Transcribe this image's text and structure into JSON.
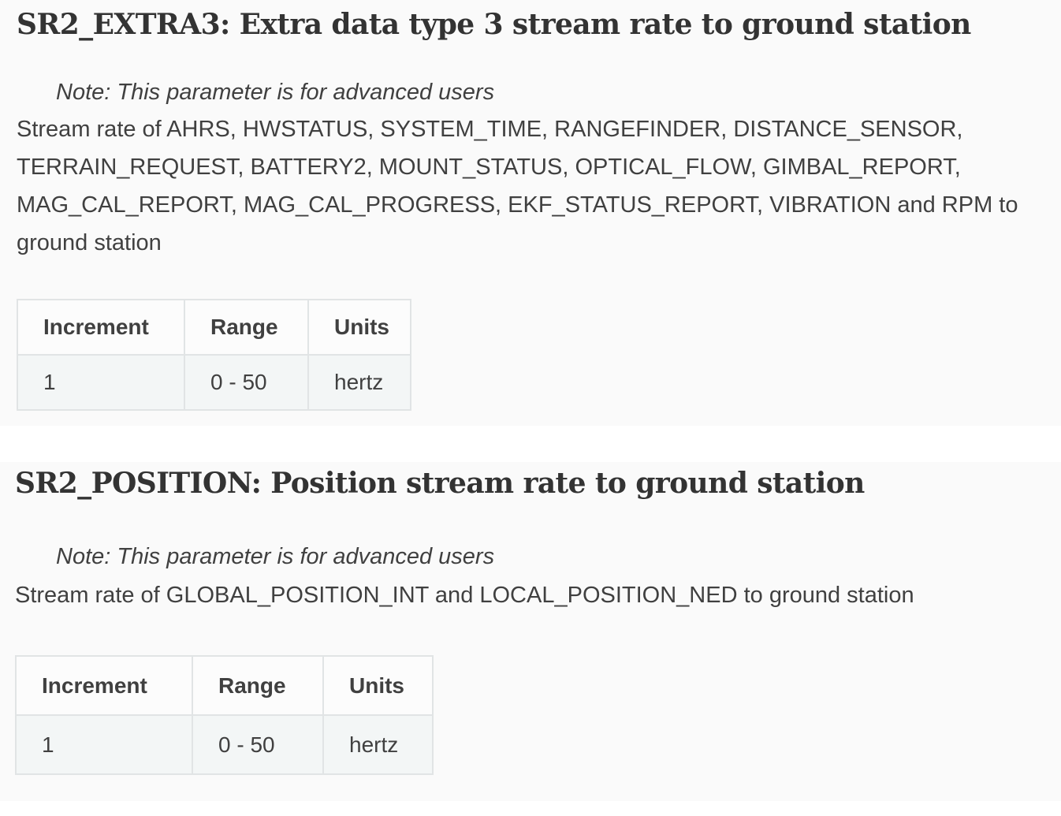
{
  "params": [
    {
      "title": "SR2_EXTRA3: Extra data type 3 stream rate to ground station",
      "note": "Note: This parameter is for advanced users",
      "description": "Stream rate of AHRS, HWSTATUS, SYSTEM_TIME, RANGEFINDER, DISTANCE_SENSOR, TERRAIN_REQUEST, BATTERY2, MOUNT_STATUS, OPTICAL_FLOW, GIMBAL_REPORT, MAG_CAL_REPORT, MAG_CAL_PROGRESS, EKF_STATUS_REPORT, VIBRATION and RPM to ground station",
      "table": {
        "headers": [
          "Increment",
          "Range",
          "Units"
        ],
        "row": [
          "1",
          "0 - 50",
          "hertz"
        ]
      }
    },
    {
      "title": "SR2_POSITION: Position stream rate to ground station",
      "note": "Note: This parameter is for advanced users",
      "description": "Stream rate of GLOBAL_POSITION_INT and LOCAL_POSITION_NED to ground station",
      "table": {
        "headers": [
          "Increment",
          "Range",
          "Units"
        ],
        "row": [
          "1",
          "0 - 50",
          "hertz"
        ]
      }
    }
  ]
}
